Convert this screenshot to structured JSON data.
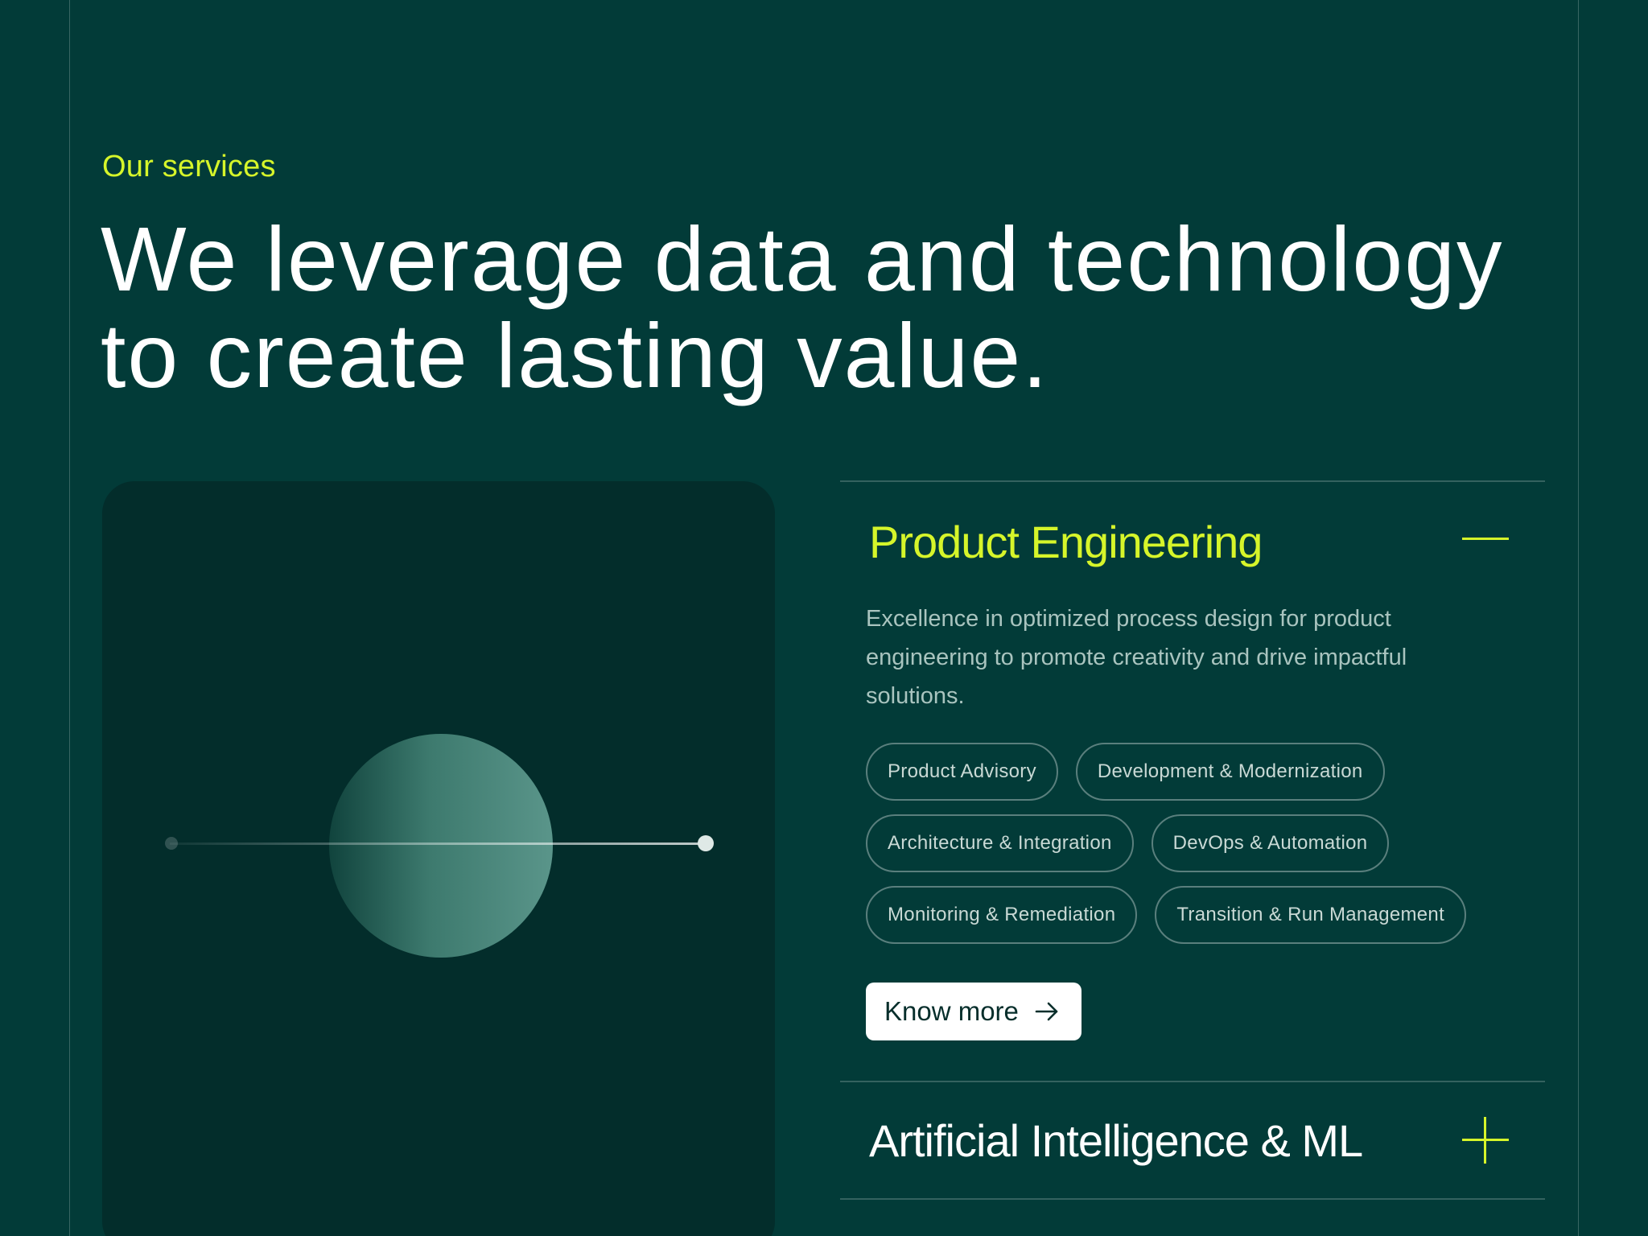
{
  "section": {
    "eyebrow": "Our services",
    "headline_line1": "We leverage data and technology",
    "headline_line2": "to create lasting value."
  },
  "colors": {
    "background": "#023b38",
    "card": "#032d2b",
    "accent": "#d6f52a",
    "text": "#ffffff",
    "muted": "#a9c4bf"
  },
  "services": [
    {
      "title": "Product Engineering",
      "expanded": true,
      "toggle_icon": "minus-icon",
      "description": "Excellence in optimized process design for product engineering to promote creativity and drive impactful solutions.",
      "tags": [
        [
          "Product Advisory",
          "Development & Modernization"
        ],
        [
          "Architecture & Integration",
          "DevOps & Automation"
        ],
        [
          "Monitoring & Remediation",
          "Transition & Run Management"
        ]
      ],
      "cta_label": "Know more",
      "cta_icon": "arrow-right-icon"
    },
    {
      "title": "Artificial Intelligence & ML",
      "expanded": false,
      "toggle_icon": "plus-icon"
    }
  ]
}
